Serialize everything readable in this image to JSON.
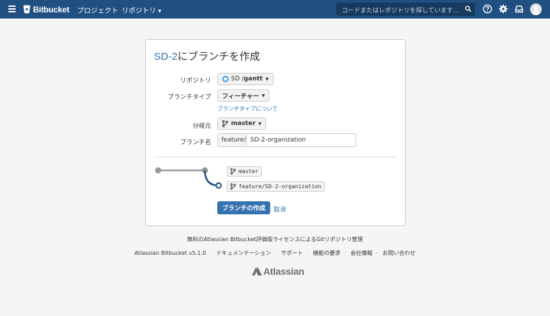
{
  "header": {
    "brand": "Bitbucket",
    "nav": {
      "projects": "プロジェクト",
      "repositories": "リポジトリ"
    },
    "search_placeholder": "コードまたはレポジトリを探しています..."
  },
  "form": {
    "title_key": "SD-2",
    "title_rest": "にブランチを作成",
    "repository": {
      "label": "リポジトリ",
      "project": "SD / ",
      "repo": "gantt"
    },
    "branch_type": {
      "label": "ブランチタイプ",
      "value": "フィーチャー",
      "help": "ブランチタイプについて"
    },
    "from_branch": {
      "label": "分岐元",
      "value": "master"
    },
    "branch_name": {
      "label": "ブランチ名",
      "prefix": "feature/",
      "value": "SD-2-organization"
    },
    "preview": {
      "source": "master",
      "target": "feature/SD-2-organization"
    },
    "create_label": "ブランチの作成",
    "cancel_label": "取消"
  },
  "footer": {
    "license": "無料のAtlassian Bitbucket評価版ライセンスによるGitリポジトリ管理",
    "links": [
      "Atlassian Bitbucket v5.1.0",
      "ドキュメンテーション",
      "サポート",
      "機能の要求",
      "会社情報",
      "お問い合わせ"
    ],
    "logo": "Atlassian"
  },
  "colors": {
    "header_bg": "#205081",
    "link": "#3572b0",
    "primary": "#3572b0"
  }
}
